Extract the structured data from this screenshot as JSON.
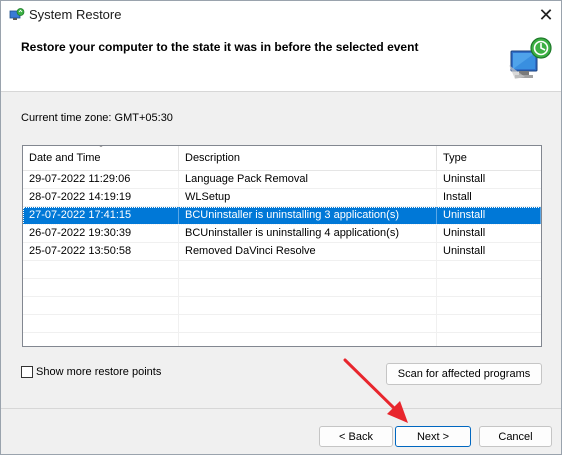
{
  "window": {
    "title": "System Restore",
    "close_glyph": "✕"
  },
  "header": {
    "title": "Restore your computer to the state it was in before the selected event"
  },
  "timezone_label": "Current time zone: GMT+05:30",
  "table": {
    "columns": [
      "Date and Time",
      "Description",
      "Type"
    ],
    "rows": [
      {
        "date": "29-07-2022 11:29:06",
        "description": "Language Pack Removal",
        "type": "Uninstall"
      },
      {
        "date": "28-07-2022 14:19:19",
        "description": "WLSetup",
        "type": "Install"
      },
      {
        "date": "27-07-2022 17:41:15",
        "description": "BCUninstaller is uninstalling 3 application(s)",
        "type": "Uninstall"
      },
      {
        "date": "26-07-2022 19:30:39",
        "description": "BCUninstaller is uninstalling 4 application(s)",
        "type": "Uninstall"
      },
      {
        "date": "25-07-2022 13:50:58",
        "description": "Removed DaVinci Resolve",
        "type": "Uninstall"
      }
    ],
    "selected_index": 2,
    "sort_indicator": "﹀"
  },
  "options": {
    "show_more_label": "Show more restore points",
    "show_more_checked": false
  },
  "buttons": {
    "scan": "Scan for affected programs",
    "back": "< Back",
    "next": "Next >",
    "cancel": "Cancel"
  },
  "icons": {
    "title_icon": "system-restore-icon",
    "header_graphic": "restore-monitor-icon"
  },
  "colors": {
    "selection": "#0078d7",
    "annotation_arrow": "#e8262d"
  }
}
